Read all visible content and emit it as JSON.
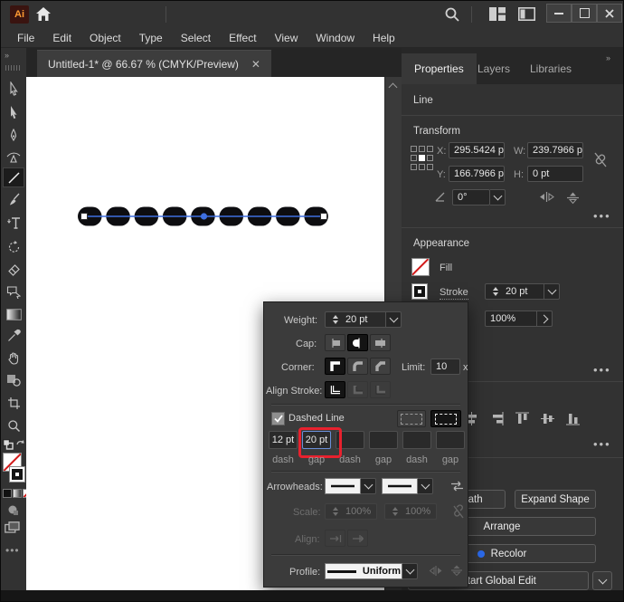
{
  "titlebar": {
    "app_badge": "Ai"
  },
  "menubar": {
    "items": [
      "File",
      "Edit",
      "Object",
      "Type",
      "Select",
      "Effect",
      "View",
      "Window",
      "Help"
    ]
  },
  "document_tab": {
    "title": "Untitled-1* @ 66.67 % (CMYK/Preview)"
  },
  "toolbar": {
    "tools": [
      "selection",
      "direct-selection",
      "pen",
      "curvature",
      "line-segment",
      "paintbrush",
      "type",
      "rotate",
      "eraser",
      "shaper",
      "gradient",
      "eyedropper",
      "hand",
      "symbol",
      "artboard",
      "zoom",
      "fill-none",
      "stroke",
      "color",
      "gradient-swatch",
      "none-swatch",
      "draw-modes",
      "screen-mode"
    ]
  },
  "right_panel": {
    "tabs": [
      "Properties",
      "Layers",
      "Libraries"
    ],
    "line_section": "Line",
    "transform": {
      "heading": "Transform",
      "x_label": "X:",
      "x_value": "295.5424 p",
      "y_label": "Y:",
      "y_value": "166.7966 p",
      "w_label": "W:",
      "w_value": "239.7966 p",
      "h_label": "H:",
      "h_value": "0 pt",
      "angle_value": "0°"
    },
    "appearance": {
      "heading": "Appearance",
      "fill_label": "Fill",
      "stroke_label": "Stroke",
      "stroke_weight": "20 pt",
      "opacity": "100%"
    },
    "quick_actions": {
      "offset_path": "Offset Path",
      "expand_shape": "Expand Shape",
      "arrange": "Arrange",
      "recolor": "Recolor",
      "start_global_edit": "Start Global Edit"
    }
  },
  "stroke_panel": {
    "weight_label": "Weight:",
    "weight_value": "20 pt",
    "cap_label": "Cap:",
    "corner_label": "Corner:",
    "limit_label": "Limit:",
    "limit_value": "10",
    "limit_unit": "x",
    "align_stroke_label": "Align Stroke:",
    "dashed_line_label": "Dashed Line",
    "dash_fields": [
      {
        "value": "12 pt",
        "label": "dash",
        "highlighted": false
      },
      {
        "value": "20 pt",
        "label": "gap",
        "highlighted": true
      },
      {
        "value": "",
        "label": "dash",
        "highlighted": false
      },
      {
        "value": "",
        "label": "gap",
        "highlighted": false
      },
      {
        "value": "",
        "label": "dash",
        "highlighted": false
      },
      {
        "value": "",
        "label": "gap",
        "highlighted": false
      }
    ],
    "arrowheads_label": "Arrowheads:",
    "scale_label": "Scale:",
    "scale_value_1": "100%",
    "scale_value_2": "100%",
    "align_label": "Align:",
    "profile_label": "Profile:",
    "profile_value": "Uniform"
  },
  "colors": {
    "selection_blue": "#3e6fe0",
    "annotation_red": "#e8212e",
    "recolor_dot": "#2c6bed",
    "canvas": "#ffffff",
    "chrome": "#323232"
  }
}
